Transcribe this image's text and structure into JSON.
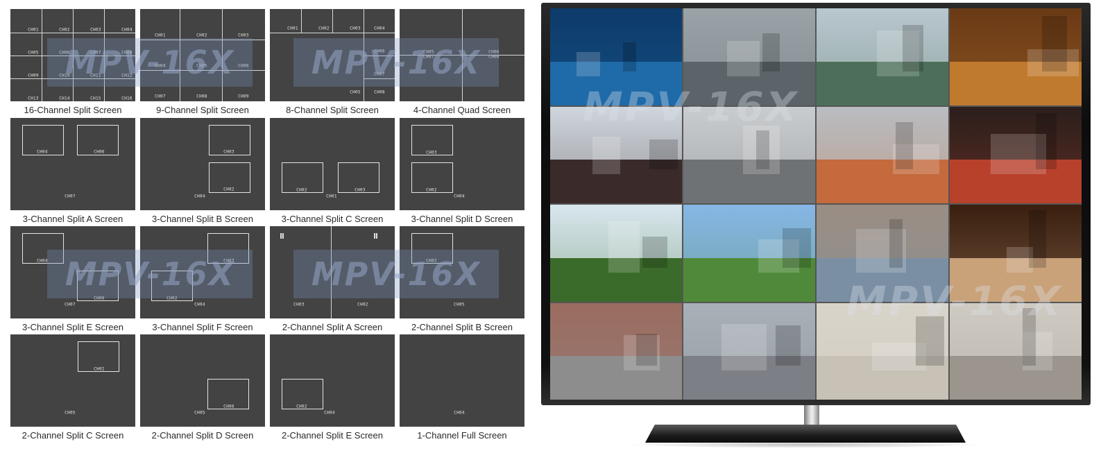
{
  "watermark": "MPV-16X",
  "layouts": [
    {
      "caption": "16-Channel Split Screen",
      "channels": [
        "CH01",
        "CH02",
        "CH03",
        "CH04",
        "CH05",
        "CH06",
        "CH07",
        "CH08",
        "CH09",
        "CH10",
        "CH11",
        "CH12",
        "CH13",
        "CH14",
        "CH15",
        "CH16"
      ]
    },
    {
      "caption": "9-Channel Split Screen",
      "channels": [
        "CH01",
        "CH02",
        "CH03",
        "CH04",
        "CH05",
        "CH06",
        "CH07",
        "CH08",
        "CH09"
      ]
    },
    {
      "caption": "8-Channel Split Screen",
      "channels": [
        "CH01",
        "CH02",
        "CH03",
        "CH04",
        "CH06",
        "CH07",
        "CH05",
        "CH08"
      ]
    },
    {
      "caption": "4-Channel Quad Screen",
      "channels": [
        "CH05",
        "CH07",
        "CH06",
        "CH08"
      ]
    },
    {
      "caption": "3-Channel Split A Screen",
      "channels": [
        "CH04",
        "CH06",
        "CH07"
      ]
    },
    {
      "caption": "3-Channel Split B Screen",
      "channels": [
        "CH03",
        "CH02",
        "CH04"
      ]
    },
    {
      "caption": "3-Channel Split C Screen",
      "channels": [
        "CH02",
        "CH03",
        "CH01"
      ]
    },
    {
      "caption": "3-Channel Split D Screen",
      "channels": [
        "CH03",
        "CH02",
        "CH04"
      ]
    },
    {
      "caption": "3-Channel Split E Screen",
      "channels": [
        "CH04",
        "CH06",
        "CH07"
      ]
    },
    {
      "caption": "3-Channel Split F Screen",
      "channels": [
        "CH03",
        "CH02",
        "CH04"
      ]
    },
    {
      "caption": "2-Channel Split A Screen",
      "channels": [
        "CH03",
        "CH02"
      ]
    },
    {
      "caption": "2-Channel Split B Screen",
      "channels": [
        "CH02",
        "CH05"
      ]
    },
    {
      "caption": "2-Channel Split C Screen",
      "channels": [
        "CH02",
        "CH05"
      ]
    },
    {
      "caption": "2-Channel Split D Screen",
      "channels": [
        "CH06",
        "CH05"
      ]
    },
    {
      "caption": "2-Channel Split E Screen",
      "channels": [
        "CH02",
        "CH04"
      ]
    },
    {
      "caption": "1-Channel Full Screen",
      "channels": [
        "CH04"
      ]
    }
  ],
  "tv": {
    "tiles": [
      {
        "scene": "video-wall-tunnel",
        "sky": "#0d3b6a",
        "ground": "#1f6aa8"
      },
      {
        "scene": "highway-traffic",
        "sky": "#9aa3a8",
        "ground": "#5b6468"
      },
      {
        "scene": "city-intersection",
        "sky": "#b9c7cf",
        "ground": "#4d6f59"
      },
      {
        "scene": "hotel-lobby",
        "sky": "#6a3a16",
        "ground": "#c07a2e"
      },
      {
        "scene": "glass-building-ticker",
        "sky": "#cfd6dd",
        "ground": "#3a2a2a"
      },
      {
        "scene": "parking-garage",
        "sky": "#c9ccce",
        "ground": "#6f7274"
      },
      {
        "scene": "parking-lot-cars",
        "sky": "#b9bdc1",
        "ground": "#c46a3c"
      },
      {
        "scene": "basketball-arena",
        "sky": "#2b1f1c",
        "ground": "#b8412c"
      },
      {
        "scene": "tree-lined-road",
        "sky": "#d8e6ee",
        "ground": "#3b6b2a"
      },
      {
        "scene": "campus-building",
        "sky": "#86b6e6",
        "ground": "#4f8a3a"
      },
      {
        "scene": "stone-buddha-caves",
        "sky": "#9a8e84",
        "ground": "#7a8fa4"
      },
      {
        "scene": "underground-hall",
        "sky": "#3a1f10",
        "ground": "#c9a27a"
      },
      {
        "scene": "street-buildings",
        "sky": "#9b6c60",
        "ground": "#8d8d8d"
      },
      {
        "scene": "airport-terminal",
        "sky": "#a8b0b8",
        "ground": "#7d7f86"
      },
      {
        "scene": "metro-concourse",
        "sky": "#d9d4ca",
        "ground": "#c7c1b6"
      },
      {
        "scene": "corridor-hall",
        "sky": "#cfcac2",
        "ground": "#9b958e"
      }
    ]
  }
}
